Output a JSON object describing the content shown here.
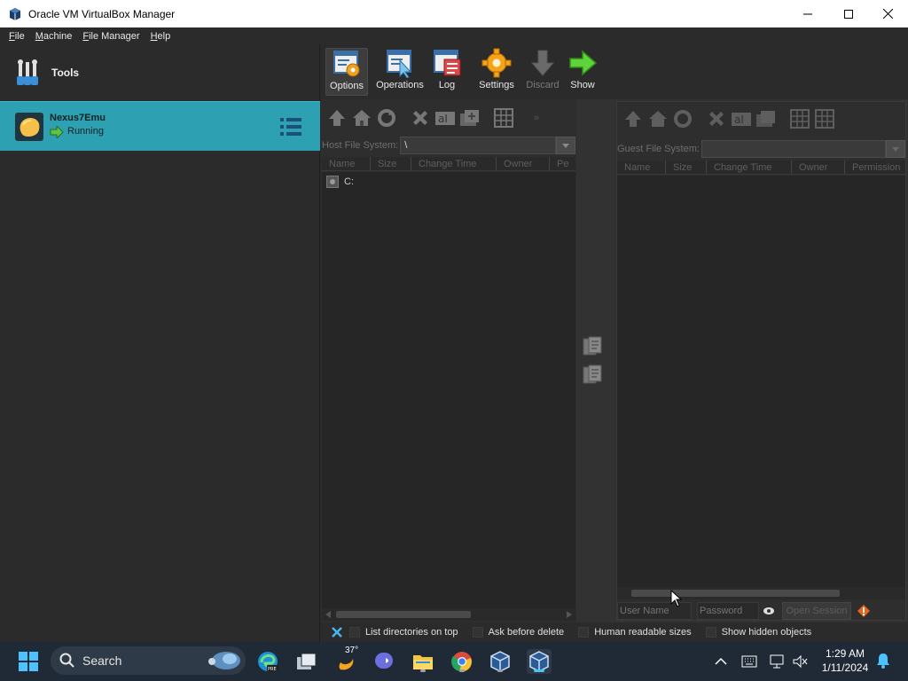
{
  "window": {
    "title": "Oracle VM VirtualBox Manager",
    "controls": {
      "minimize": "minimize-icon",
      "maximize": "maximize-icon",
      "close": "close-icon"
    }
  },
  "menu": {
    "items": [
      {
        "label": "File",
        "accel": "F",
        "rest": "ile"
      },
      {
        "label": "Machine",
        "accel": "M",
        "rest": "achine"
      },
      {
        "label": "File Manager",
        "accel": "F",
        "rest": "ile Manager"
      },
      {
        "label": "Help",
        "accel": "H",
        "rest": "elp"
      }
    ]
  },
  "sidebar": {
    "tools_label": "Tools",
    "vm": {
      "name": "Nexus7Emu",
      "state": "Running"
    }
  },
  "toolbar": {
    "options": "Options",
    "operations": "Operations",
    "log": "Log",
    "settings": "Settings",
    "discard": "Discard",
    "show": "Show"
  },
  "host_panel": {
    "path_label": "Host File System:",
    "path_value": "\\",
    "columns": [
      "Name",
      "Size",
      "Change Time",
      "Owner",
      "Pe"
    ],
    "rows": [
      {
        "name": "C:"
      }
    ]
  },
  "guest_panel": {
    "path_label": "Guest File System:",
    "path_value": "",
    "columns": [
      "Name",
      "Size",
      "Change Time",
      "Owner",
      "Permission"
    ],
    "user_placeholder": "User Name",
    "password_placeholder": "Password",
    "open_session": "Open Session"
  },
  "statusbar": {
    "list_dirs": "List directories on top",
    "ask_delete": "Ask before delete",
    "human_sizes": "Human readable sizes",
    "show_hidden": "Show hidden objects"
  },
  "taskbar": {
    "search": "Search",
    "weather": "37°",
    "time": "1:29 AM",
    "date": "1/11/2024"
  },
  "colors": {
    "selection": "#2da0b2",
    "background": "#2b2b2b",
    "taskbar": "#1f2a36"
  }
}
